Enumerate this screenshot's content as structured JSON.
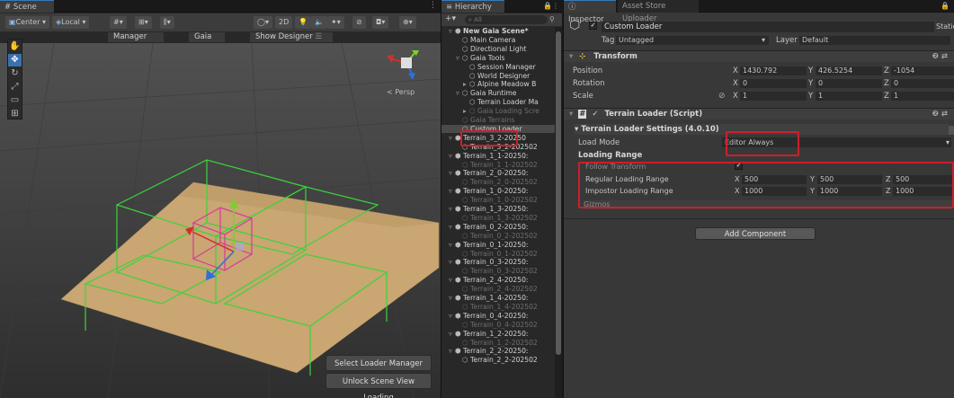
{
  "scene": {
    "tab": "# Scene",
    "toolbar": {
      "pivot_label": "Center ▾",
      "space_label": "Local ▾",
      "grid_labels": [
        "▾",
        "▾",
        "▾"
      ],
      "mode_2d": "2D",
      "gizmo_labels": [
        "▾",
        "▾",
        "▾",
        "▾"
      ]
    },
    "overlay": {
      "manager": "Manager",
      "gaia": "Gaia",
      "show_designer": "Show Designer"
    },
    "persp_label": "< Persp",
    "buttons": {
      "select_loader": "Select Loader Manager",
      "unlock_loading": "Unlock Scene View Loading"
    }
  },
  "hierarchy": {
    "tab": "≡ Hierarchy",
    "search_placeholder": "All",
    "add_label": "+▾",
    "items": [
      {
        "label": "New Gaia Scene*",
        "indent": 0,
        "arrow": "▿",
        "dim": false,
        "selected": false,
        "bold": true
      },
      {
        "label": "Main Camera",
        "indent": 1,
        "arrow": "",
        "dim": false,
        "selected": false
      },
      {
        "label": "Directional Light",
        "indent": 1,
        "arrow": "",
        "dim": false,
        "selected": false
      },
      {
        "label": "Gaia Tools",
        "indent": 1,
        "arrow": "▿",
        "dim": false,
        "selected": false
      },
      {
        "label": "Session Manager",
        "indent": 2,
        "arrow": "",
        "dim": false,
        "selected": false
      },
      {
        "label": "World Designer",
        "indent": 2,
        "arrow": "",
        "dim": false,
        "selected": false
      },
      {
        "label": "Alpine Meadow B",
        "indent": 2,
        "arrow": "▸",
        "dim": false,
        "selected": false
      },
      {
        "label": "Gaia Runtime",
        "indent": 1,
        "arrow": "▿",
        "dim": false,
        "selected": false
      },
      {
        "label": "Terrain Loader Ma",
        "indent": 2,
        "arrow": "",
        "dim": false,
        "selected": false
      },
      {
        "label": "Gaia Loading Scre",
        "indent": 2,
        "arrow": "▸",
        "dim": true,
        "selected": false
      },
      {
        "label": "Gaia Terrains",
        "indent": 1,
        "arrow": "",
        "dim": true,
        "selected": false
      },
      {
        "label": "Custom Loader",
        "indent": 1,
        "arrow": "",
        "dim": false,
        "selected": true
      },
      {
        "label": "Terrain_3_2-20250",
        "indent": 0,
        "arrow": "▿",
        "dim": false,
        "selected": false
      },
      {
        "label": "Terrain_3_2-202502",
        "indent": 1,
        "arrow": "",
        "dim": false,
        "selected": false
      },
      {
        "label": "Terrain_1_1-20250:",
        "indent": 0,
        "arrow": "▿",
        "dim": false,
        "selected": false
      },
      {
        "label": "Terrain_1_1-202502",
        "indent": 1,
        "arrow": "",
        "dim": true,
        "selected": false
      },
      {
        "label": "Terrain_2_0-20250:",
        "indent": 0,
        "arrow": "▿",
        "dim": false,
        "selected": false
      },
      {
        "label": "Terrain_2_0-202502",
        "indent": 1,
        "arrow": "",
        "dim": true,
        "selected": false
      },
      {
        "label": "Terrain_1_0-20250:",
        "indent": 0,
        "arrow": "▿",
        "dim": false,
        "selected": false
      },
      {
        "label": "Terrain_1_0-202502",
        "indent": 1,
        "arrow": "",
        "dim": true,
        "selected": false
      },
      {
        "label": "Terrain_1_3-20250:",
        "indent": 0,
        "arrow": "▿",
        "dim": false,
        "selected": false
      },
      {
        "label": "Terrain_1_3-202502",
        "indent": 1,
        "arrow": "",
        "dim": true,
        "selected": false
      },
      {
        "label": "Terrain_0_2-20250:",
        "indent": 0,
        "arrow": "▿",
        "dim": false,
        "selected": false
      },
      {
        "label": "Terrain_0_2-202502",
        "indent": 1,
        "arrow": "",
        "dim": true,
        "selected": false
      },
      {
        "label": "Terrain_0_1-20250:",
        "indent": 0,
        "arrow": "▿",
        "dim": false,
        "selected": false
      },
      {
        "label": "Terrain_0_1-202502",
        "indent": 1,
        "arrow": "",
        "dim": true,
        "selected": false
      },
      {
        "label": "Terrain_0_3-20250:",
        "indent": 0,
        "arrow": "▿",
        "dim": false,
        "selected": false
      },
      {
        "label": "Terrain_0_3-202502",
        "indent": 1,
        "arrow": "",
        "dim": true,
        "selected": false
      },
      {
        "label": "Terrain_2_4-20250:",
        "indent": 0,
        "arrow": "▿",
        "dim": false,
        "selected": false
      },
      {
        "label": "Terrain_2_4-202502",
        "indent": 1,
        "arrow": "",
        "dim": true,
        "selected": false
      },
      {
        "label": "Terrain_1_4-20250:",
        "indent": 0,
        "arrow": "▿",
        "dim": false,
        "selected": false
      },
      {
        "label": "Terrain_1_4-202502",
        "indent": 1,
        "arrow": "",
        "dim": true,
        "selected": false
      },
      {
        "label": "Terrain_0_4-20250:",
        "indent": 0,
        "arrow": "▿",
        "dim": false,
        "selected": false
      },
      {
        "label": "Terrain_0_4-202502",
        "indent": 1,
        "arrow": "",
        "dim": true,
        "selected": false
      },
      {
        "label": "Terrain_1_2-20250:",
        "indent": 0,
        "arrow": "▿",
        "dim": false,
        "selected": false
      },
      {
        "label": "Terrain_1_2-202502",
        "indent": 1,
        "arrow": "",
        "dim": true,
        "selected": false
      },
      {
        "label": "Terrain_2_2-20250:",
        "indent": 0,
        "arrow": "▿",
        "dim": false,
        "selected": false
      },
      {
        "label": "Terrain_2_2-202502",
        "indent": 1,
        "arrow": "",
        "dim": false,
        "selected": false
      }
    ]
  },
  "inspector": {
    "tab": "Inspector",
    "tab2": "Asset Store Uploader",
    "object_name": "Custom Loader",
    "static_label": "Static",
    "tag_label": "Tag",
    "tag_value": "Untagged",
    "layer_label": "Layer",
    "layer_value": "Default",
    "transform": {
      "title": "Transform",
      "rows": [
        {
          "label": "Position",
          "x": "1430.792",
          "y": "426.5254",
          "z": "-1054"
        },
        {
          "label": "Rotation",
          "x": "0",
          "y": "0",
          "z": "0"
        },
        {
          "label": "Scale",
          "x": "1",
          "y": "1",
          "z": "1"
        }
      ],
      "axis": {
        "x": "X",
        "y": "Y",
        "z": "Z"
      }
    },
    "loader": {
      "title": "Terrain Loader (Script)",
      "settings_title": "Terrain Loader Settings (4.0.10)",
      "load_mode_label": "Load Mode",
      "load_mode_value": "Editor Always",
      "loading_range_label": "Loading Range",
      "follow_transform_label": "Follow Transform",
      "regular_label": "Regular Loading Range",
      "regular": {
        "x": "500",
        "y": "500",
        "z": "500"
      },
      "impostor_label": "Impostor Loading Range",
      "impostor": {
        "x": "1000",
        "y": "1000",
        "z": "1000"
      },
      "gizmos_label": "Gizmos"
    },
    "add_component": "Add Component"
  },
  "colors": {
    "highlight_red": "#cc1f2a",
    "accent_blue": "#3a72b0",
    "terrain_tan": "#c9a672",
    "bounds_green": "#3bd43b",
    "loader_magenta": "#d9399b"
  }
}
